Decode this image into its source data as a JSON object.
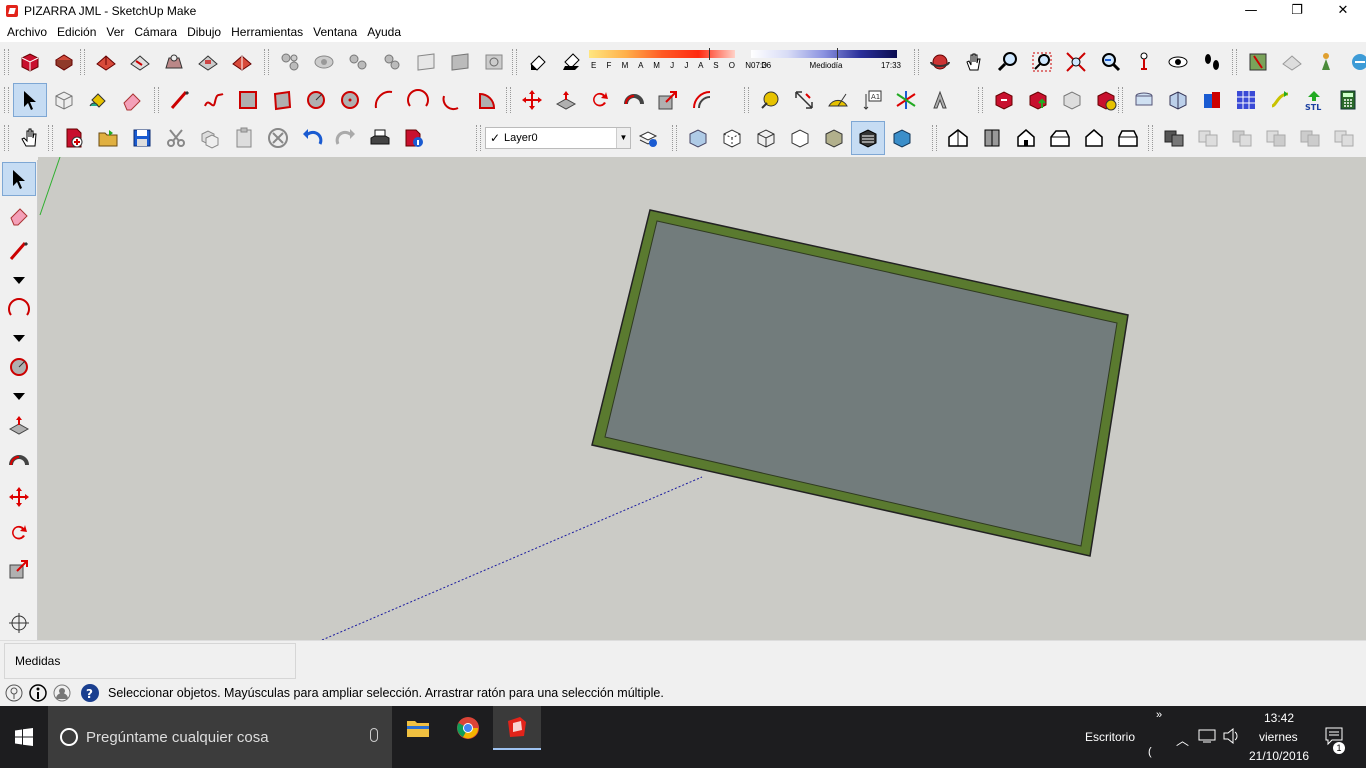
{
  "window": {
    "title": "PIZARRA JML - SketchUp Make",
    "minimize": "—",
    "restore": "❐",
    "close": "✕"
  },
  "menu": [
    "Archivo",
    "Edición",
    "Ver",
    "Cámara",
    "Dibujo",
    "Herramientas",
    "Ventana",
    "Ayuda"
  ],
  "shadows": {
    "months": "E F M A M J J A S O N D",
    "time_start": "07:36",
    "time_mid": "Mediodía",
    "time_end": "17:33"
  },
  "layers": {
    "current": "Layer0"
  },
  "measurements": {
    "label": "Medidas",
    "value": ""
  },
  "status": {
    "text": "Seleccionar objetos. Mayúsculas para ampliar selección. Arrastrar ratón para una selección múltiple."
  },
  "taskbar": {
    "search_placeholder": "Pregúntame cualquier cosa",
    "desktop_label": "Escritorio",
    "time": "13:42",
    "day": "viernes",
    "date": "21/10/2016",
    "notifications": "1"
  },
  "colors": {
    "viewport_bg": "#cbcbc6",
    "board_frame": "#5a7a2f",
    "board_face": "#727c7c",
    "accent_red": "#c8102e"
  }
}
